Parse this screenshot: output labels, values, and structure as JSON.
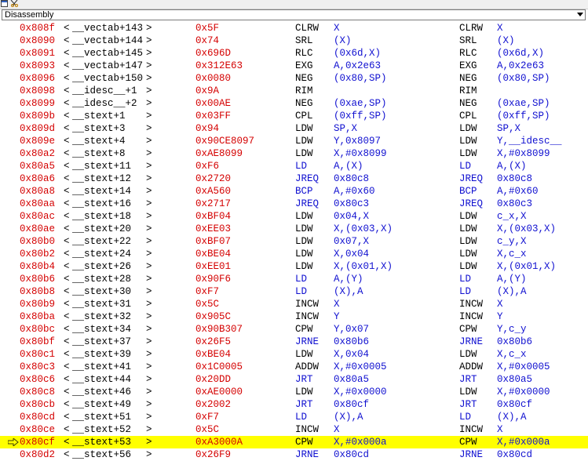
{
  "toolbar": {
    "icons": [
      "window-icon",
      "cut-icon"
    ]
  },
  "panel": {
    "title": "Disassembly"
  },
  "current_row_index": 33,
  "rows": [
    {
      "addr": "0x808f",
      "sym": "__vectab+143",
      "op": "0x5F",
      "m1": "CLRW",
      "a1": "X",
      "m2": "CLRW",
      "a2": "X"
    },
    {
      "addr": "0x8090",
      "sym": "__vectab+144",
      "op": "0x74",
      "m1": "SRL",
      "a1": "(X)",
      "m2": "SRL",
      "a2": "(X)"
    },
    {
      "addr": "0x8091",
      "sym": "__vectab+145",
      "op": "0x696D",
      "m1": "RLC",
      "a1": "(0x6d,X)",
      "m2": "RLC",
      "a2": "(0x6d,X)"
    },
    {
      "addr": "0x8093",
      "sym": "__vectab+147",
      "op": "0x312E63",
      "m1": "EXG",
      "a1": "A,0x2e63",
      "m2": "EXG",
      "a2": "A,0x2e63"
    },
    {
      "addr": "0x8096",
      "sym": "__vectab+150",
      "op": "0x0080",
      "m1": "NEG",
      "a1": "(0x80,SP)",
      "m2": "NEG",
      "a2": "(0x80,SP)"
    },
    {
      "addr": "0x8098",
      "sym": "__idesc__+1",
      "op": "0x9A",
      "m1": "RIM",
      "a1": "",
      "m2": "RIM",
      "a2": ""
    },
    {
      "addr": "0x8099",
      "sym": "__idesc__+2",
      "op": "0x00AE",
      "m1": "NEG",
      "a1": "(0xae,SP)",
      "m2": "NEG",
      "a2": "(0xae,SP)"
    },
    {
      "addr": "0x809b",
      "sym": "__stext+1",
      "op": "0x03FF",
      "m1": "CPL",
      "a1": "(0xff,SP)",
      "m2": "CPL",
      "a2": "(0xff,SP)"
    },
    {
      "addr": "0x809d",
      "sym": "__stext+3",
      "op": "0x94",
      "m1": "LDW",
      "a1": "SP,X",
      "m2": "LDW",
      "a2": "SP,X"
    },
    {
      "addr": "0x809e",
      "sym": "__stext+4",
      "op": "0x90CE8097",
      "m1": "LDW",
      "a1": "Y,0x8097",
      "m2": "LDW",
      "a2": "Y,__idesc__"
    },
    {
      "addr": "0x80a2",
      "sym": "__stext+8",
      "op": "0xAE8099",
      "m1": "LDW",
      "a1": "X,#0x8099",
      "m2": "LDW",
      "a2": "X,#0x8099"
    },
    {
      "addr": "0x80a5",
      "sym": "__stext+11",
      "op": "0xF6",
      "m1": "LD",
      "a1": "A,(X)",
      "m2": "LD",
      "a2": "A,(X)",
      "blue": true
    },
    {
      "addr": "0x80a6",
      "sym": "__stext+12",
      "op": "0x2720",
      "m1": "JREQ",
      "a1": "0x80c8",
      "m2": "JREQ",
      "a2": "0x80c8",
      "blue": true
    },
    {
      "addr": "0x80a8",
      "sym": "__stext+14",
      "op": "0xA560",
      "m1": "BCP",
      "a1": "A,#0x60",
      "m2": "BCP",
      "a2": "A,#0x60",
      "blue": true
    },
    {
      "addr": "0x80aa",
      "sym": "__stext+16",
      "op": "0x2717",
      "m1": "JREQ",
      "a1": "0x80c3",
      "m2": "JREQ",
      "a2": "0x80c3",
      "blue": true
    },
    {
      "addr": "0x80ac",
      "sym": "__stext+18",
      "op": "0xBF04",
      "m1": "LDW",
      "a1": "0x04,X",
      "m2": "LDW",
      "a2": "c_x,X"
    },
    {
      "addr": "0x80ae",
      "sym": "__stext+20",
      "op": "0xEE03",
      "m1": "LDW",
      "a1": "X,(0x03,X)",
      "m2": "LDW",
      "a2": "X,(0x03,X)"
    },
    {
      "addr": "0x80b0",
      "sym": "__stext+22",
      "op": "0xBF07",
      "m1": "LDW",
      "a1": "0x07,X",
      "m2": "LDW",
      "a2": "c_y,X"
    },
    {
      "addr": "0x80b2",
      "sym": "__stext+24",
      "op": "0xBE04",
      "m1": "LDW",
      "a1": "X,0x04",
      "m2": "LDW",
      "a2": "X,c_x"
    },
    {
      "addr": "0x80b4",
      "sym": "__stext+26",
      "op": "0xEE01",
      "m1": "LDW",
      "a1": "X,(0x01,X)",
      "m2": "LDW",
      "a2": "X,(0x01,X)"
    },
    {
      "addr": "0x80b6",
      "sym": "__stext+28",
      "op": "0x90F6",
      "m1": "LD",
      "a1": "A,(Y)",
      "m2": "LD",
      "a2": "A,(Y)",
      "blue": true
    },
    {
      "addr": "0x80b8",
      "sym": "__stext+30",
      "op": "0xF7",
      "m1": "LD",
      "a1": "(X),A",
      "m2": "LD",
      "a2": "(X),A",
      "blue": true
    },
    {
      "addr": "0x80b9",
      "sym": "__stext+31",
      "op": "0x5C",
      "m1": "INCW",
      "a1": "X",
      "m2": "INCW",
      "a2": "X"
    },
    {
      "addr": "0x80ba",
      "sym": "__stext+32",
      "op": "0x905C",
      "m1": "INCW",
      "a1": "Y",
      "m2": "INCW",
      "a2": "Y"
    },
    {
      "addr": "0x80bc",
      "sym": "__stext+34",
      "op": "0x90B307",
      "m1": "CPW",
      "a1": "Y,0x07",
      "m2": "CPW",
      "a2": "Y,c_y"
    },
    {
      "addr": "0x80bf",
      "sym": "__stext+37",
      "op": "0x26F5",
      "m1": "JRNE",
      "a1": "0x80b6",
      "m2": "JRNE",
      "a2": "0x80b6",
      "blue": true
    },
    {
      "addr": "0x80c1",
      "sym": "__stext+39",
      "op": "0xBE04",
      "m1": "LDW",
      "a1": "X,0x04",
      "m2": "LDW",
      "a2": "X,c_x"
    },
    {
      "addr": "0x80c3",
      "sym": "__stext+41",
      "op": "0x1C0005",
      "m1": "ADDW",
      "a1": "X,#0x0005",
      "m2": "ADDW",
      "a2": "X,#0x0005"
    },
    {
      "addr": "0x80c6",
      "sym": "__stext+44",
      "op": "0x20DD",
      "m1": "JRT",
      "a1": "0x80a5",
      "m2": "JRT",
      "a2": "0x80a5",
      "blue": true
    },
    {
      "addr": "0x80c8",
      "sym": "__stext+46",
      "op": "0xAE0000",
      "m1": "LDW",
      "a1": "X,#0x0000",
      "m2": "LDW",
      "a2": "X,#0x0000"
    },
    {
      "addr": "0x80cb",
      "sym": "__stext+49",
      "op": "0x2002",
      "m1": "JRT",
      "a1": "0x80cf",
      "m2": "JRT",
      "a2": "0x80cf",
      "blue": true
    },
    {
      "addr": "0x80cd",
      "sym": "__stext+51",
      "op": "0xF7",
      "m1": "LD",
      "a1": "(X),A",
      "m2": "LD",
      "a2": "(X),A",
      "blue": true
    },
    {
      "addr": "0x80ce",
      "sym": "__stext+52",
      "op": "0x5C",
      "m1": "INCW",
      "a1": "X",
      "m2": "INCW",
      "a2": "X"
    },
    {
      "addr": "0x80cf",
      "sym": "__stext+53",
      "op": "0xA3000A",
      "m1": "CPW",
      "a1": "X,#0x000a",
      "m2": "CPW",
      "a2": "X,#0x000a"
    },
    {
      "addr": "0x80d2",
      "sym": "__stext+56",
      "op": "0x26F9",
      "m1": "JRNE",
      "a1": "0x80cd",
      "m2": "JRNE",
      "a2": "0x80cd",
      "blue": true
    }
  ],
  "colors": {
    "address": "#d40000",
    "operand": "#1010d0",
    "highlight": "#ffff00"
  }
}
